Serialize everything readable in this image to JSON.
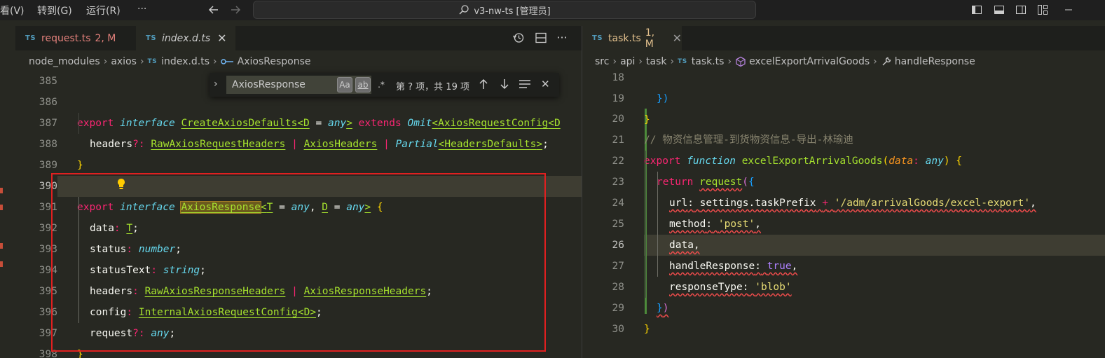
{
  "menu": [
    "看(V)",
    "转到(G)",
    "运行(R)",
    "···"
  ],
  "search_box": "v3-nw-ts [管理员]",
  "left_tabs": [
    {
      "badge": "TS",
      "label": "request.ts",
      "status": "2, M"
    },
    {
      "badge": "TS",
      "label": "index.d.ts"
    }
  ],
  "right_tab": {
    "badge": "TS",
    "label": "task.ts",
    "status": "1, M"
  },
  "left_breadcrumb": [
    "node_modules",
    "axios",
    "index.d.ts",
    "AxiosResponse"
  ],
  "right_breadcrumb": [
    "src",
    "api",
    "task",
    "task.ts",
    "excelExportArrivalGoods",
    "handleResponse"
  ],
  "find": {
    "query": "AxiosResponse",
    "opt_case": "Aa",
    "opt_word": "ab",
    "opt_regex": ".*",
    "result": "第 ? 项，共 19 项"
  },
  "left_line_numbers": [
    "385",
    "386",
    "387",
    "388",
    "389",
    "390",
    "391",
    "392",
    "393",
    "394",
    "395",
    "396",
    "397",
    "398"
  ],
  "right_line_numbers": [
    "18",
    "19",
    "20",
    "21",
    "22",
    "23",
    "24",
    "25",
    "26",
    "27",
    "28",
    "29",
    "30"
  ],
  "left_code": {
    "l386_export": "export",
    "l386_interface": "interface",
    "l386_name": "CreateAxiosDefaults",
    "l386_D": "D",
    "l386_any": "any",
    "l386_extends": "extends",
    "l386_omit": "Omit",
    "l386_cfg": "AxiosRequestConfig",
    "l386_tail": "D",
    "l387_headers": "headers",
    "l387_t1": "RawAxiosRequestHeaders",
    "l387_t2": "AxiosHeaders",
    "l387_partial": "Partial",
    "l387_t3": "HeadersDefaults",
    "l390_export": "export",
    "l390_interface": "interface",
    "l390_name": "AxiosResponse",
    "l390_T": "T",
    "l390_any1": "any",
    "l390_D": "D",
    "l390_any2": "any",
    "l391_prop": "data",
    "l391_type": "T",
    "l392_prop": "status",
    "l392_type": "number",
    "l393_prop": "statusText",
    "l393_type": "string",
    "l394_prop": "headers",
    "l394_t1": "RawAxiosResponseHeaders",
    "l394_t2": "AxiosResponseHeaders",
    "l395_prop": "config",
    "l395_type": "InternalAxiosRequestConfig",
    "l395_D": "D",
    "l396_prop": "request",
    "l396_type": "any"
  },
  "right_code": {
    "l20_comment": "// 物资信息管理-到货物资信息-导出-林瑜迪",
    "l21_export": "export",
    "l21_function": "function",
    "l21_name": "excelExportArrivalGoods",
    "l21_param": "data",
    "l21_type": "any",
    "l22_return": "return",
    "l22_call": "request",
    "l23_key": "url",
    "l23_obj": "settings.taskPrefix",
    "l23_str": "'/adm/arrivalGoods/excel-export'",
    "l24_key": "method",
    "l24_str": "'post'",
    "l25_key": "data",
    "l26_key": "handleResponse",
    "l26_val": "true",
    "l27_key": "responseType",
    "l27_str": "'blob'"
  },
  "colors": {
    "editor_bg": "#272822",
    "keyword": "#f92672",
    "storage": "#66d9ef",
    "type": "#a6e22e",
    "string": "#e6db74",
    "annotation_box": "#e02020"
  }
}
